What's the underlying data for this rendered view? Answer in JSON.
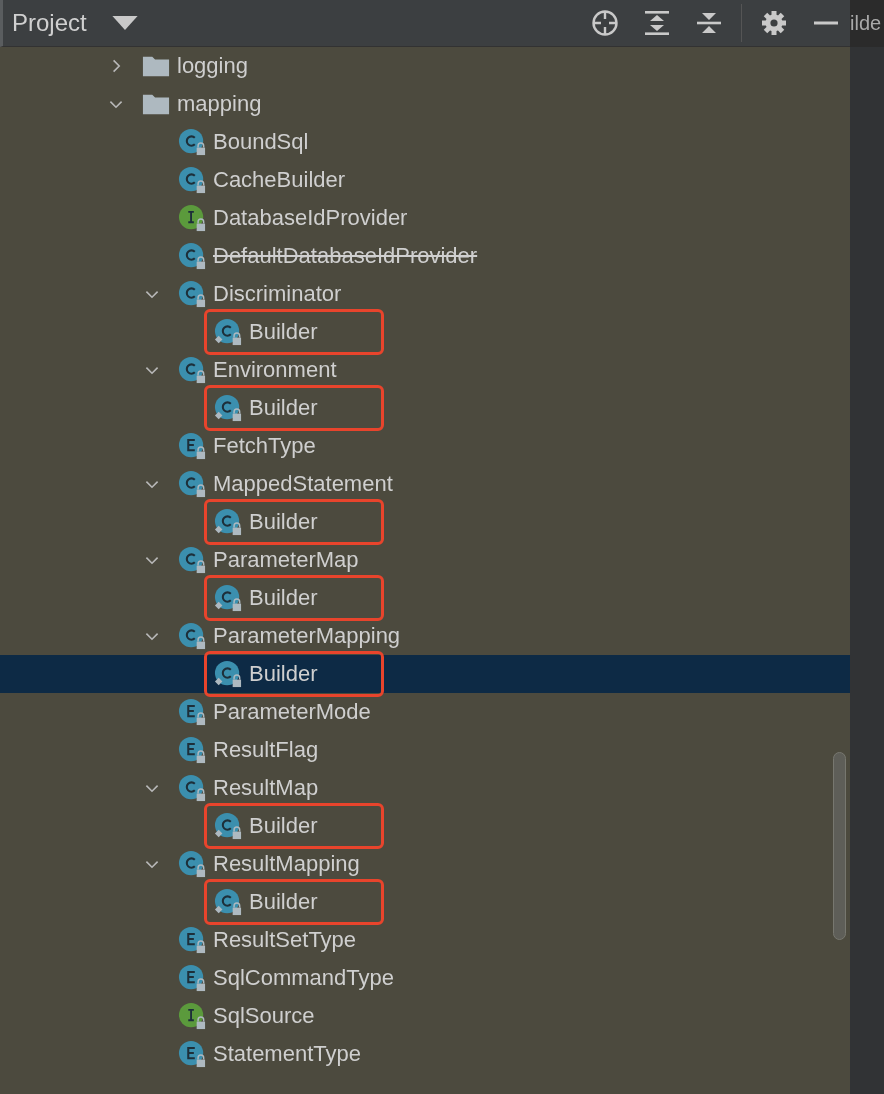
{
  "toolwindow": {
    "title": "Project"
  },
  "editor_tab": {
    "label": "ilde"
  },
  "tree": [
    {
      "label": "logging",
      "kind": "folder",
      "expanded": false,
      "selected": false,
      "deprecated": false,
      "annotated": false
    },
    {
      "label": "mapping",
      "kind": "folder",
      "expanded": true,
      "selected": false,
      "deprecated": false,
      "annotated": false,
      "children": [
        {
          "label": "BoundSql",
          "kind": "class",
          "selected": false,
          "deprecated": false,
          "annotated": false
        },
        {
          "label": "CacheBuilder",
          "kind": "class",
          "selected": false,
          "deprecated": false,
          "annotated": false
        },
        {
          "label": "DatabaseIdProvider",
          "kind": "interface",
          "selected": false,
          "deprecated": false,
          "annotated": false
        },
        {
          "label": "DefaultDatabaseIdProvider",
          "kind": "class",
          "selected": false,
          "deprecated": true,
          "annotated": false
        },
        {
          "label": "Discriminator",
          "kind": "class",
          "expanded": true,
          "selected": false,
          "deprecated": false,
          "annotated": false,
          "children": [
            {
              "label": "Builder",
              "kind": "nested",
              "selected": false,
              "deprecated": false,
              "annotated": true
            }
          ]
        },
        {
          "label": "Environment",
          "kind": "class",
          "expanded": true,
          "selected": false,
          "deprecated": false,
          "annotated": false,
          "children": [
            {
              "label": "Builder",
              "kind": "nested",
              "selected": false,
              "deprecated": false,
              "annotated": true
            }
          ]
        },
        {
          "label": "FetchType",
          "kind": "enum",
          "selected": false,
          "deprecated": false,
          "annotated": false
        },
        {
          "label": "MappedStatement",
          "kind": "class",
          "expanded": true,
          "selected": false,
          "deprecated": false,
          "annotated": false,
          "children": [
            {
              "label": "Builder",
              "kind": "nested",
              "selected": false,
              "deprecated": false,
              "annotated": true
            }
          ]
        },
        {
          "label": "ParameterMap",
          "kind": "class",
          "expanded": true,
          "selected": false,
          "deprecated": false,
          "annotated": false,
          "children": [
            {
              "label": "Builder",
              "kind": "nested",
              "selected": false,
              "deprecated": false,
              "annotated": true
            }
          ]
        },
        {
          "label": "ParameterMapping",
          "kind": "class",
          "expanded": true,
          "selected": false,
          "deprecated": false,
          "annotated": false,
          "children": [
            {
              "label": "Builder",
              "kind": "nested",
              "selected": true,
              "deprecated": false,
              "annotated": true
            }
          ]
        },
        {
          "label": "ParameterMode",
          "kind": "enum",
          "selected": false,
          "deprecated": false,
          "annotated": false
        },
        {
          "label": "ResultFlag",
          "kind": "enum",
          "selected": false,
          "deprecated": false,
          "annotated": false
        },
        {
          "label": "ResultMap",
          "kind": "class",
          "expanded": true,
          "selected": false,
          "deprecated": false,
          "annotated": false,
          "children": [
            {
              "label": "Builder",
              "kind": "nested",
              "selected": false,
              "deprecated": false,
              "annotated": true
            }
          ]
        },
        {
          "label": "ResultMapping",
          "kind": "class",
          "expanded": true,
          "selected": false,
          "deprecated": false,
          "annotated": false,
          "children": [
            {
              "label": "Builder",
              "kind": "nested",
              "selected": false,
              "deprecated": false,
              "annotated": true
            }
          ]
        },
        {
          "label": "ResultSetType",
          "kind": "enum",
          "selected": false,
          "deprecated": false,
          "annotated": false
        },
        {
          "label": "SqlCommandType",
          "kind": "enum",
          "selected": false,
          "deprecated": false,
          "annotated": false
        },
        {
          "label": "SqlSource",
          "kind": "interface",
          "selected": false,
          "deprecated": false,
          "annotated": false
        },
        {
          "label": "StatementType",
          "kind": "enum",
          "selected": false,
          "deprecated": false,
          "annotated": false
        }
      ]
    }
  ]
}
